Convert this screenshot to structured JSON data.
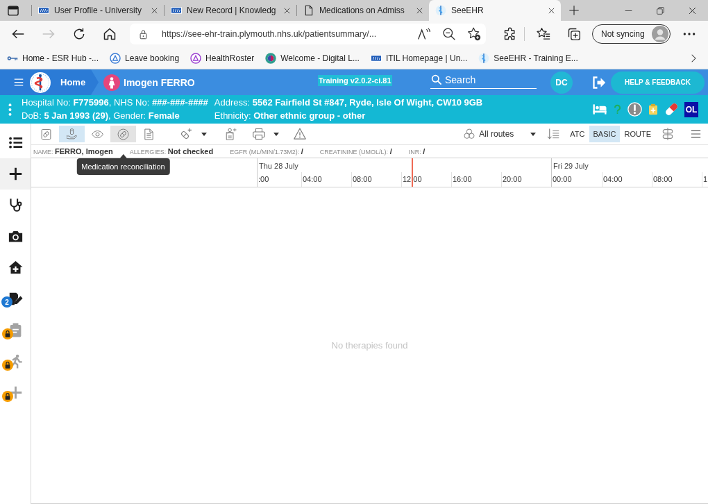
{
  "browser": {
    "tabs": [
      {
        "title": "User Profile - University",
        "selected": false
      },
      {
        "title": "New Record | Knowledg",
        "selected": false
      },
      {
        "title": "Medications on Admiss",
        "selected": false
      },
      {
        "title": "SeeEHR",
        "selected": true
      }
    ],
    "forward_disabled": true,
    "address": "https://see-ehr-train.plymouth.nhs.uk/patientsummary/...",
    "profile_button": "Not syncing",
    "bookmarks": [
      "Home - ESR Hub -...",
      "Leave booking",
      "HealthRoster",
      "Welcome - Digital L...",
      "ITIL Homepage | Un...",
      "SeeEHR - Training E..."
    ]
  },
  "app_header": {
    "home_link": "Home",
    "patient_name": "Imogen FERRO",
    "version_label": "Training v2.0.2-ci.81",
    "search": {
      "placeholder": "Search"
    },
    "user_initials": "DC",
    "help_button": "HELP & FEEDBACK"
  },
  "patient_banner": {
    "rows": [
      [
        "Hospital No: **F775996**, NHS No: **###-###-####**",
        "Address: **5562 Fairfield St #847, Ryde, Isle Of Wight, CW10 9GB**"
      ],
      [
        "DoB: **5 Jan 1993 (29)**, Gender: **Female**",
        "Ethnicity: **Other ethnic group - other**"
      ]
    ],
    "status_badge": "OL"
  },
  "sidebar": {
    "items": [
      {
        "selected": false,
        "locked": false
      },
      {
        "selected": true,
        "locked": false
      },
      {
        "selected": false,
        "locked": false
      },
      {
        "selected": false,
        "locked": false
      },
      {
        "selected": false,
        "locked": false
      },
      {
        "selected": false,
        "locked": false,
        "badge": "2"
      },
      {
        "selected": false,
        "locked": true
      },
      {
        "selected": false,
        "locked": true
      },
      {
        "selected": false,
        "locked": true
      }
    ]
  },
  "toolbar": {
    "view_buttons": [
      {
        "selected": false,
        "hovered": false
      },
      {
        "selected": true,
        "hovered": false
      },
      {
        "selected": false,
        "hovered": false
      },
      {
        "selected": false,
        "hovered": true,
        "tooltip": "Medication reconciliation"
      },
      {
        "selected": false,
        "hovered": false
      }
    ],
    "route_filter": "All routes",
    "sort_modes": [
      {
        "label": "ATC",
        "selected": false
      },
      {
        "label": "BASIC",
        "selected": true
      },
      {
        "label": "ROUTE",
        "selected": false
      }
    ]
  },
  "summary": [
    "NAME: **FERRO, Imogen**",
    "ALLERGIES: **Not checked**",
    "EGFR (ML/MIN/1.73M2): **/**",
    "CREATININE (UMOL/L): **/**",
    "INR: **/**"
  ],
  "timeline": {
    "days": [
      {
        "label": "Thu 28 July",
        "hours": [
          ":00",
          "04:00",
          "08:00",
          "12:00",
          "16:00",
          "20:00"
        ]
      },
      {
        "label": "Fri 29 July",
        "hours": [
          "00:00",
          "04:00",
          "08:00",
          "1"
        ]
      }
    ],
    "empty_message": "No therapies found"
  }
}
